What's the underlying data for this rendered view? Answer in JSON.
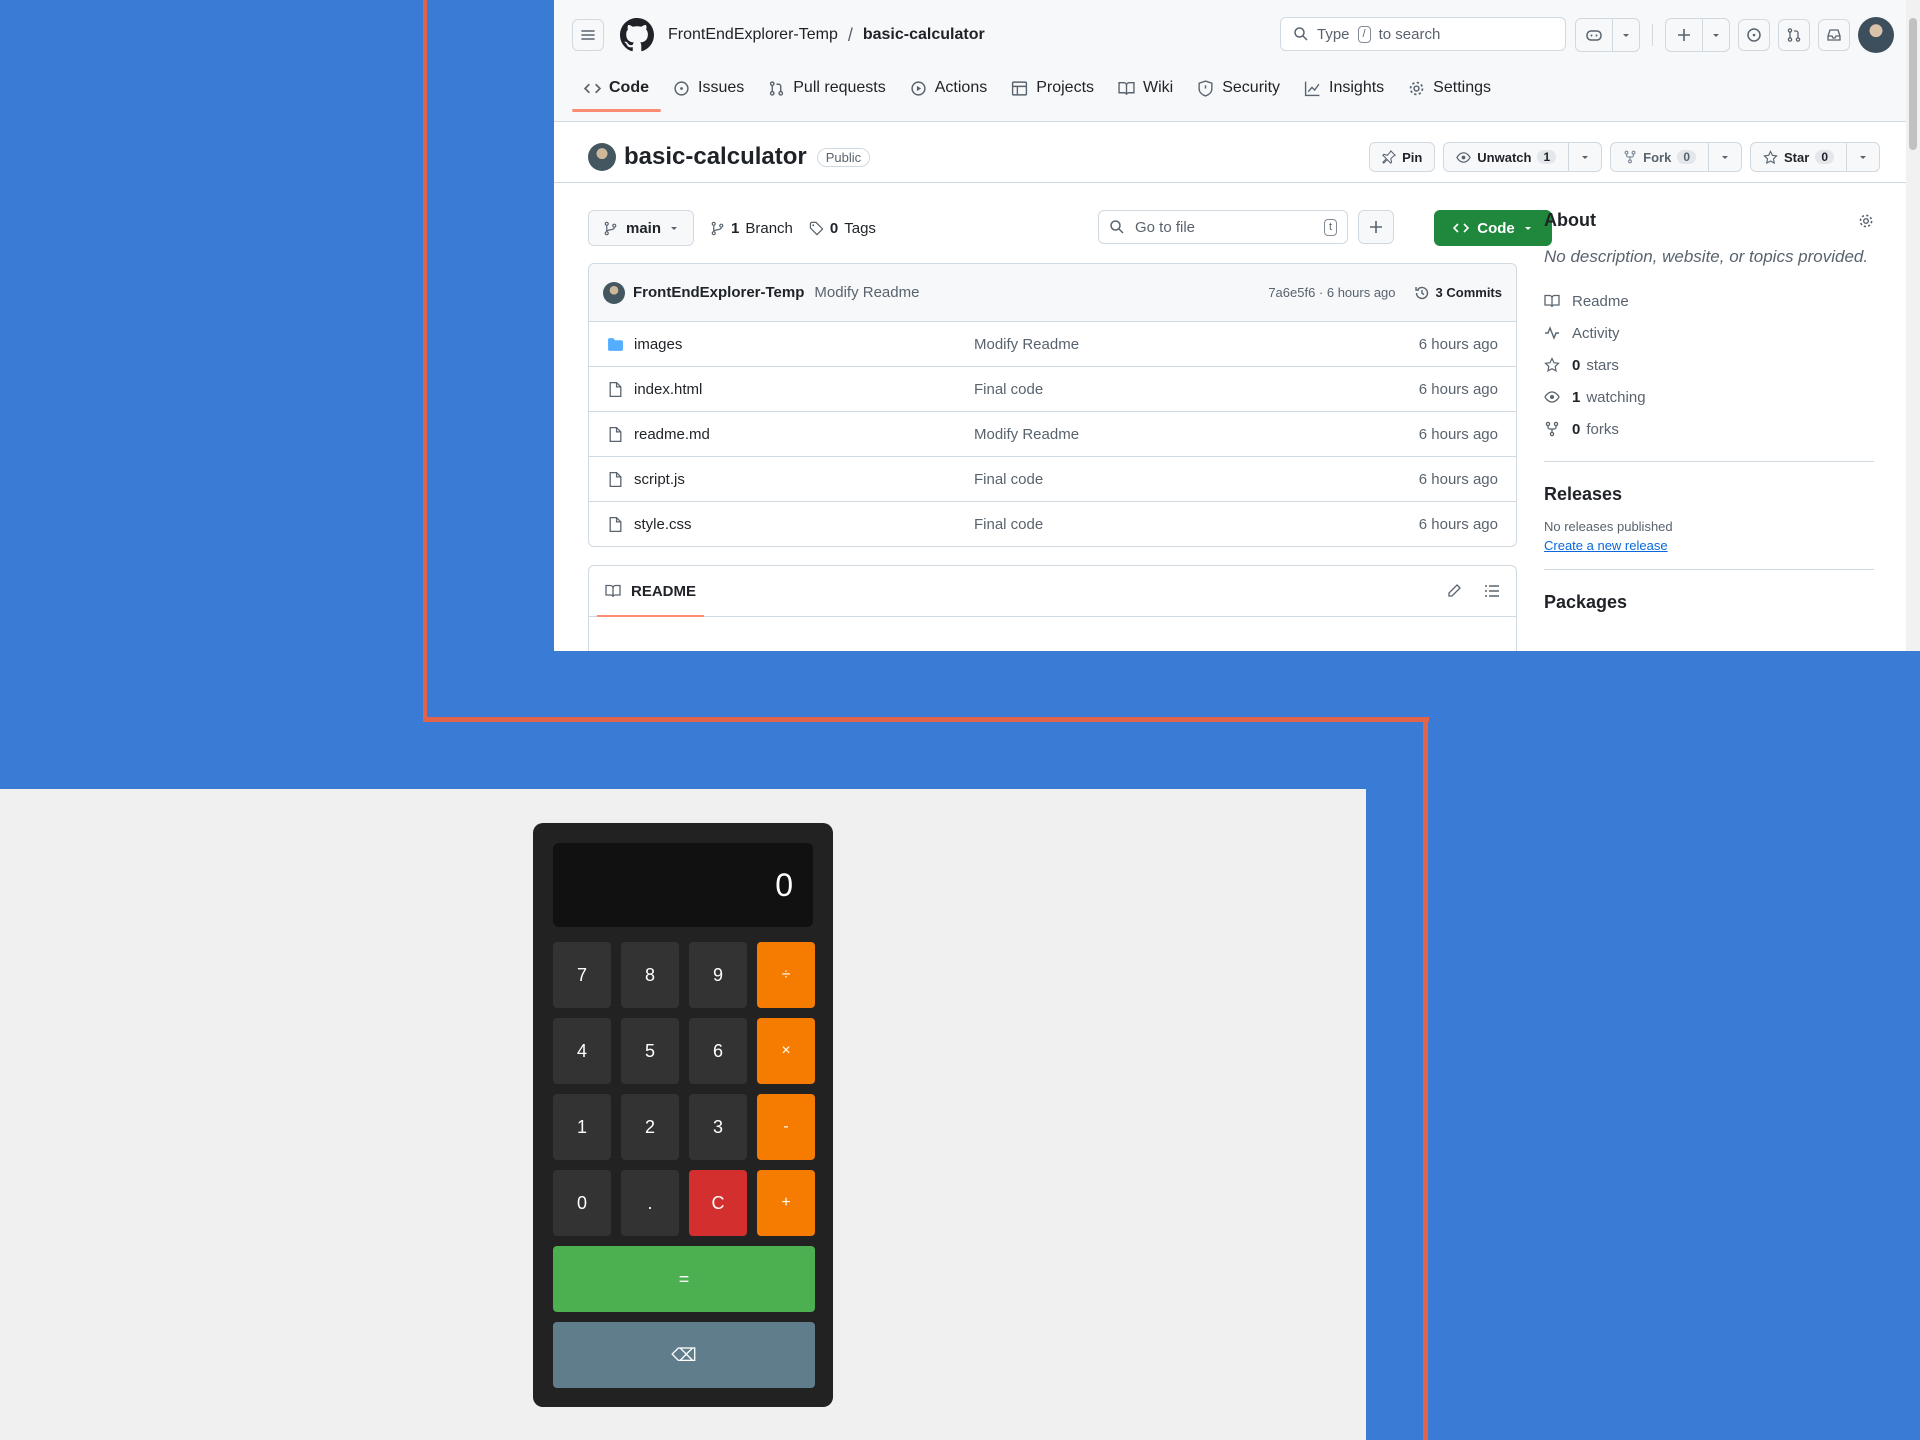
{
  "github": {
    "owner": "FrontEndExplorer-Temp",
    "repo": "basic-calculator",
    "search_placeholder_pre": "Type",
    "search_key": "/",
    "search_placeholder_post": "to search",
    "tabs": [
      {
        "label": "Code",
        "icon": "code-icon",
        "active": true
      },
      {
        "label": "Issues",
        "icon": "issue-icon"
      },
      {
        "label": "Pull requests",
        "icon": "pull-request-icon"
      },
      {
        "label": "Actions",
        "icon": "play-icon"
      },
      {
        "label": "Projects",
        "icon": "table-icon"
      },
      {
        "label": "Wiki",
        "icon": "book-icon"
      },
      {
        "label": "Security",
        "icon": "shield-icon"
      },
      {
        "label": "Insights",
        "icon": "graph-icon"
      },
      {
        "label": "Settings",
        "icon": "gear-icon"
      }
    ],
    "visibility": "Public",
    "actions": {
      "pin": "Pin",
      "unwatch": "Unwatch",
      "watch_count": "1",
      "fork": "Fork",
      "fork_count": "0",
      "star": "Star",
      "star_count": "0"
    },
    "branch": "main",
    "branches_count": "1",
    "branches_label": "Branch",
    "tags_count": "0",
    "tags_label": "Tags",
    "gofile_placeholder": "Go to file",
    "gofile_key": "t",
    "code_button": "Code",
    "commit": {
      "user": "FrontEndExplorer-Temp",
      "message": "Modify Readme",
      "hash_time": "7a6e5f6 · 6 hours ago",
      "commits": "3 Commits"
    },
    "files": [
      {
        "name": "images",
        "type": "folder",
        "message": "Modify Readme",
        "age": "6 hours ago"
      },
      {
        "name": "index.html",
        "type": "file",
        "message": "Final code",
        "age": "6 hours ago"
      },
      {
        "name": "readme.md",
        "type": "file",
        "message": "Modify Readme",
        "age": "6 hours ago"
      },
      {
        "name": "script.js",
        "type": "file",
        "message": "Final code",
        "age": "6 hours ago"
      },
      {
        "name": "style.css",
        "type": "file",
        "message": "Final code",
        "age": "6 hours ago"
      }
    ],
    "readme_label": "README",
    "about": {
      "title": "About",
      "description": "No description, website, or topics provided.",
      "items": [
        {
          "icon": "book-icon",
          "label": "Readme"
        },
        {
          "icon": "pulse-icon",
          "label": "Activity"
        },
        {
          "icon": "star-icon",
          "count": "0",
          "label": "stars"
        },
        {
          "icon": "eye-icon",
          "count": "1",
          "label": "watching"
        },
        {
          "icon": "fork-icon",
          "count": "0",
          "label": "forks"
        }
      ]
    },
    "releases": {
      "title": "Releases",
      "none": "No releases published",
      "create": "Create a new release"
    },
    "packages_title": "Packages"
  },
  "calculator": {
    "display": "0",
    "keys": [
      "7",
      "8",
      "9",
      "÷",
      "4",
      "5",
      "6",
      "×",
      "1",
      "2",
      "3",
      "-",
      "0",
      ".",
      "C",
      "+"
    ],
    "equals": "=",
    "backspace": "⌫"
  },
  "colors": {
    "desktop": "#3a7bd5",
    "accent_line": "#e0634a",
    "operator": "#f57c00",
    "clear": "#d32f2f",
    "equals": "#4caf50",
    "backspace": "#607d8b",
    "github_green": "#1f883d"
  }
}
